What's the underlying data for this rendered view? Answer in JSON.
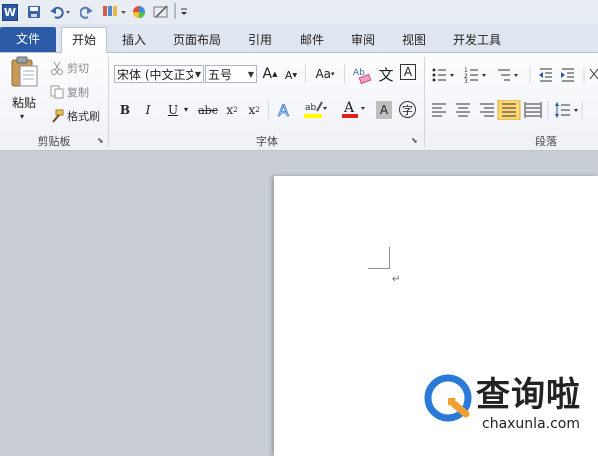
{
  "qat": {
    "app_icon": "W",
    "save_icon": "save-icon",
    "undo_icon": "undo-icon",
    "redo_icon": "redo-icon"
  },
  "tabs": {
    "file": "文件",
    "items": [
      "开始",
      "插入",
      "页面布局",
      "引用",
      "邮件",
      "审阅",
      "视图",
      "开发工具"
    ]
  },
  "clipboard": {
    "paste": "粘贴",
    "cut": "剪切",
    "copy": "复制",
    "format_painter": "格式刷",
    "label": "剪贴板"
  },
  "font": {
    "name": "宋体 (中文正文)",
    "size": "五号",
    "grow": "A",
    "shrink": "A",
    "case": "Aa",
    "bold": "B",
    "italic": "I",
    "underline": "U",
    "strike": "abc",
    "sub": "x",
    "sup": "x",
    "label": "字体",
    "phonetic": "文",
    "border_char": "A",
    "enclose_char": "字"
  },
  "paragraph": {
    "label": "段落"
  },
  "colors": {
    "file_tab": "#2b5aa6",
    "highlight": "#ffff00",
    "font_color": "#e02020"
  },
  "watermark": {
    "name": "查询啦",
    "url": "chaxunla.com"
  }
}
